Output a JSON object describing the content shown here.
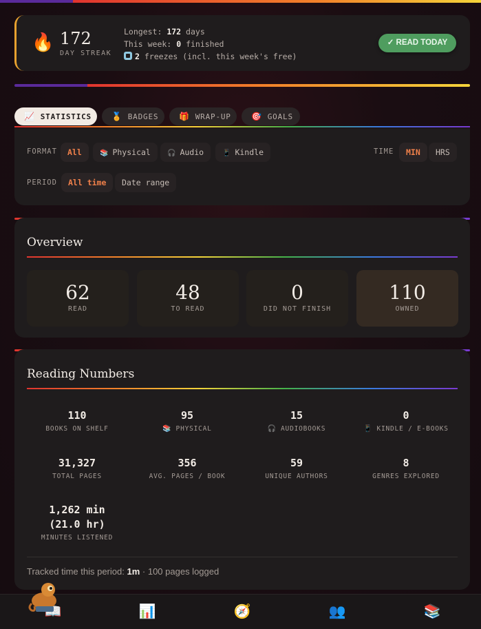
{
  "streak": {
    "count": "172",
    "label": "DAY STREAK",
    "longest_prefix": "Longest:",
    "longest_value": "172",
    "longest_suffix": "days",
    "week_prefix": "This week:",
    "week_value": "0",
    "week_suffix": "finished",
    "freezes_value": "2",
    "freezes_suffix": "freezes (incl. this week's free)",
    "button": "✓ READ TODAY"
  },
  "tabs": [
    {
      "label": "STATISTICS",
      "icon": "chart-icon"
    },
    {
      "label": "BADGES",
      "icon": "medal-icon"
    },
    {
      "label": "WRAP-UP",
      "icon": "gift-icon"
    },
    {
      "label": "GOALS",
      "icon": "target-icon"
    }
  ],
  "filters": {
    "format_label": "FORMAT",
    "format_options": [
      "All",
      "Physical",
      "Audio",
      "Kindle"
    ],
    "format_selected": "All",
    "time_label": "TIME",
    "time_options": [
      "MIN",
      "HRS"
    ],
    "time_selected": "MIN",
    "period_label": "PERIOD",
    "period_options": [
      "All time",
      "Date range"
    ],
    "period_selected": "All time"
  },
  "overview": {
    "title": "Overview",
    "items": [
      {
        "value": "62",
        "label": "READ"
      },
      {
        "value": "48",
        "label": "TO READ"
      },
      {
        "value": "0",
        "label": "DID NOT FINISH"
      },
      {
        "value": "110",
        "label": "OWNED"
      }
    ]
  },
  "numbers": {
    "title": "Reading Numbers",
    "items": [
      {
        "value": "110",
        "label": "BOOKS ON SHELF"
      },
      {
        "value": "95",
        "label": "PHYSICAL"
      },
      {
        "value": "15",
        "label": "AUDIOBOOKS"
      },
      {
        "value": "0",
        "label": "KINDLE / E-BOOKS"
      },
      {
        "value": "31,327",
        "label": "TOTAL PAGES"
      },
      {
        "value": "356",
        "label": "AVG. PAGES / BOOK"
      },
      {
        "value": "59",
        "label": "UNIQUE AUTHORS"
      },
      {
        "value": "8",
        "label": "GENRES EXPLORED"
      },
      {
        "value": "1,262 min",
        "value2": "(21.0 hr)",
        "label": "MINUTES LISTENED"
      }
    ],
    "tracked_prefix": "Tracked time this period:",
    "tracked_value": "1m",
    "tracked_suffix": "· 100 pages logged"
  },
  "nav": [
    "home-icon",
    "stats-icon",
    "compass-icon",
    "friends-icon",
    "library-icon"
  ],
  "colors": {
    "accent": "#f0804a",
    "button_green": "#4f9d5f",
    "streak_border": "#e8a12f"
  }
}
